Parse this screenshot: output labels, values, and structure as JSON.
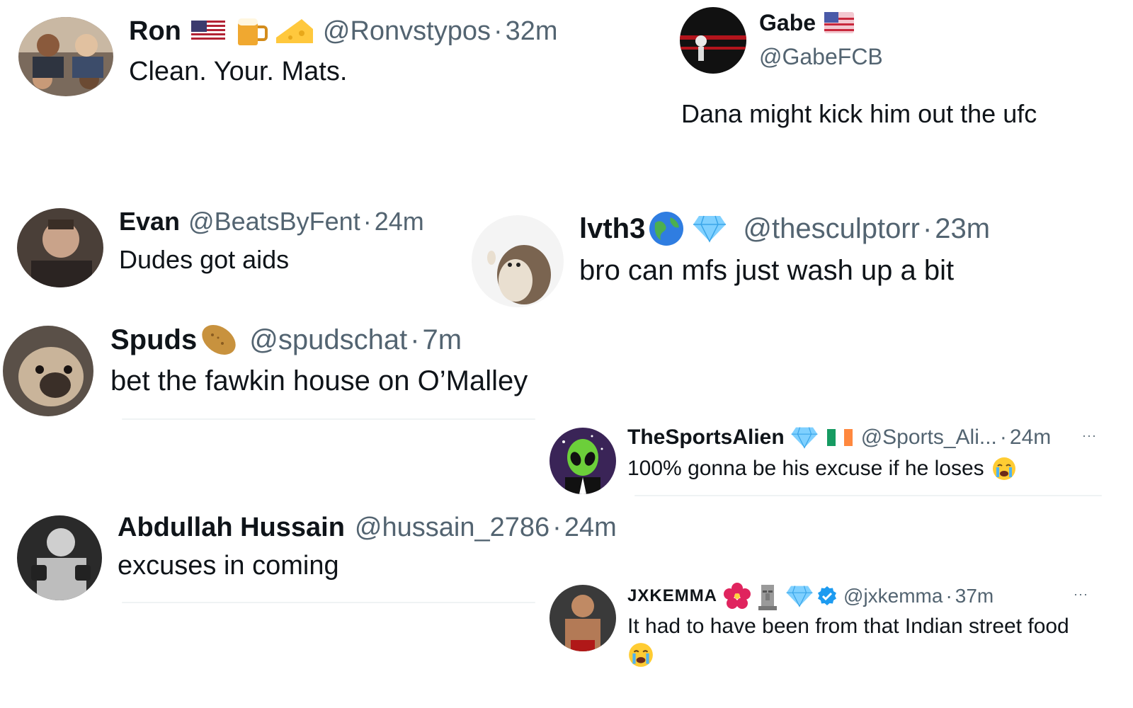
{
  "colors": {
    "text": "#0f1419",
    "secondary": "#536471",
    "divider": "#eff3f4",
    "verified": "#1d9bf0"
  },
  "replies": [
    {
      "id": "ron",
      "name": "Ron",
      "badges": [
        "us-flag-icon",
        "beer-mug-icon",
        "cheese-icon"
      ],
      "handle": "@Ronvstypos",
      "separator": "·",
      "time": "32m",
      "text": "Clean. Your. Mats."
    },
    {
      "id": "gabe",
      "name": "Gabe",
      "badges": [
        "us-flag-icon"
      ],
      "handle": "@GabeFCB",
      "text": "Dana might kick him out the ufc"
    },
    {
      "id": "evan",
      "name": "Evan",
      "handle": "@BeatsByFent",
      "separator": "·",
      "time": "24m",
      "text": "Dudes got aids"
    },
    {
      "id": "lvth3",
      "name": "lvth3",
      "badges": [
        "globe-icon",
        "diamond-icon"
      ],
      "handle": "@thesculptorr",
      "separator": "·",
      "time": "23m",
      "text": "bro can mfs just wash up a bit"
    },
    {
      "id": "spuds",
      "name": "Spuds",
      "badges": [
        "potato-icon"
      ],
      "handle": "@spudschat",
      "separator": "·",
      "time": "7m",
      "text": "bet the fawkin house on O’Malley"
    },
    {
      "id": "sportsalien",
      "name": "TheSportsAlien",
      "badges": [
        "diamond-icon",
        "ireland-flag-icon"
      ],
      "handle": "@Sports_Ali...",
      "separator": "·",
      "time": "24m",
      "more": "···",
      "text": "100% gonna be his excuse if he loses",
      "trailing_emoji": "crying-face-icon"
    },
    {
      "id": "abdullah",
      "name": "Abdullah Hussain",
      "handle": "@hussain_2786",
      "separator": "·",
      "time": "24m",
      "text": "excuses in coming"
    },
    {
      "id": "jxkemma",
      "name": "JXKEMMA",
      "badges": [
        "hibiscus-icon",
        "moai-icon",
        "diamond-icon",
        "verified-badge-icon"
      ],
      "handle": "@jxkemma",
      "separator": "·",
      "time": "37m",
      "more": "···",
      "text": "It had to have been from that Indian street food",
      "trailing_emoji": "crying-face-icon"
    }
  ]
}
